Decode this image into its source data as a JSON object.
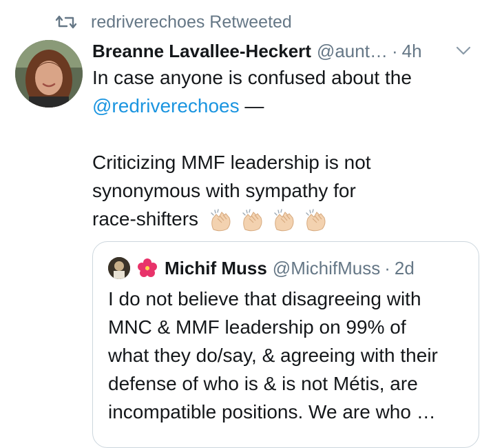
{
  "retweet": {
    "icon": "retweet-icon",
    "text": "redriverechoes Retweeted"
  },
  "tweet": {
    "avatar_icon": "user-avatar",
    "name": "Breanne Lavallee-Heckert",
    "handle": "@aunt…",
    "separator": "·",
    "time": "4h",
    "menu_icon": "chevron-down-icon",
    "line1": "In case anyone is confused about the",
    "mention": "@redriverechoes",
    "line2_suffix": " —",
    "line3": "Criticizing MMF leadership is not",
    "line4": "synonymous with sympathy for",
    "line5": "race-shifters",
    "emoji": [
      "clapping-hands-icon",
      "clapping-hands-icon",
      "clapping-hands-icon",
      "clapping-hands-icon"
    ]
  },
  "quoted": {
    "avatar_icon": "user-avatar",
    "flower_icon": "hibiscus-icon",
    "name": "Michif Muss",
    "handle": "@MichifMuss",
    "separator": "·",
    "time": "2d",
    "lines": [
      "I do not believe that disagreeing with",
      "MNC & MMF leadership on 99% of",
      "what they do/say, & agreeing with their",
      "defense of who is & is not Métis, are",
      "incompatible positions. We are who …"
    ]
  },
  "colors": {
    "link": "#1b95e0",
    "muted": "#657786",
    "text": "#14171a",
    "border": "#ccd6dd"
  }
}
